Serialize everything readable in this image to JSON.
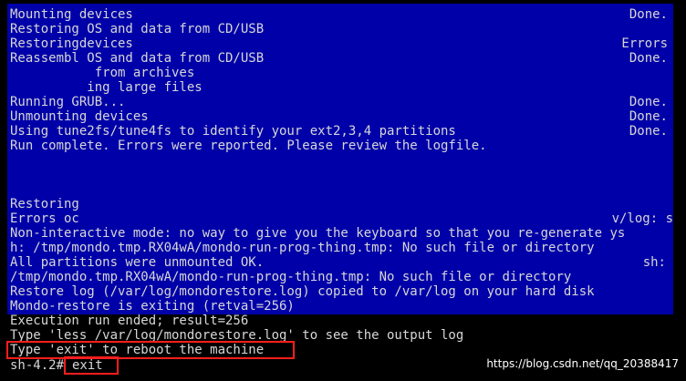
{
  "terminal": {
    "blue_lines": [
      "Mounting devices",
      "Restoring OS and data from CD/USB",
      "Restoringdevices",
      "Reassembl OS and data from CD/USB",
      "           from archives",
      "          ing large files",
      "Running GRUB...",
      "Unmounting devices",
      "Using tune2fs/tune4fs to identify your ext2,3,4 partitions",
      "Run complete. Errors were reported. Please review the logfile.",
      "",
      "",
      "",
      "Restoring",
      "Errors oc",
      "Non-interactive mode: no way to give you the keyboard so that you re-generate ys",
      "h: /tmp/mondo.tmp.RX04wA/mondo-run-prog-thing.tmp: No such file or directory",
      "All partitions were unmounted OK.",
      "/tmp/mondo.tmp.RX04wA/mondo-run-prog-thing.tmp: No such file or directory",
      "Restore log (/var/log/mondorestore.log) copied to /var/log on your hard disk",
      "Mondo-restore is exiting (retval=256)"
    ],
    "status_items": [
      {
        "row": 0,
        "text": "Done."
      },
      {
        "row": 2,
        "text": "Errors"
      },
      {
        "row": 3,
        "text": "Done."
      },
      {
        "row": 6,
        "text": "Done."
      },
      {
        "row": 7,
        "text": "Done."
      },
      {
        "row": 8,
        "text": "Done."
      },
      {
        "row": 14,
        "text": "v/log: s"
      },
      {
        "row": 17,
        "text": "sh:"
      }
    ],
    "black_lines": [
      "Execution run ended; result=256",
      "Type 'less /var/log/mondorestore.log' to see the output log",
      "Type 'exit' to reboot the machine"
    ],
    "prompt": "sh-4.2# ",
    "command": "exit"
  },
  "watermark": "https://blog.csdn.net/qq_20388417",
  "colors": {
    "panel_blue": "#0000a8",
    "text_gray": "#d7d7d7",
    "highlight_red": "#ff1d1d"
  }
}
